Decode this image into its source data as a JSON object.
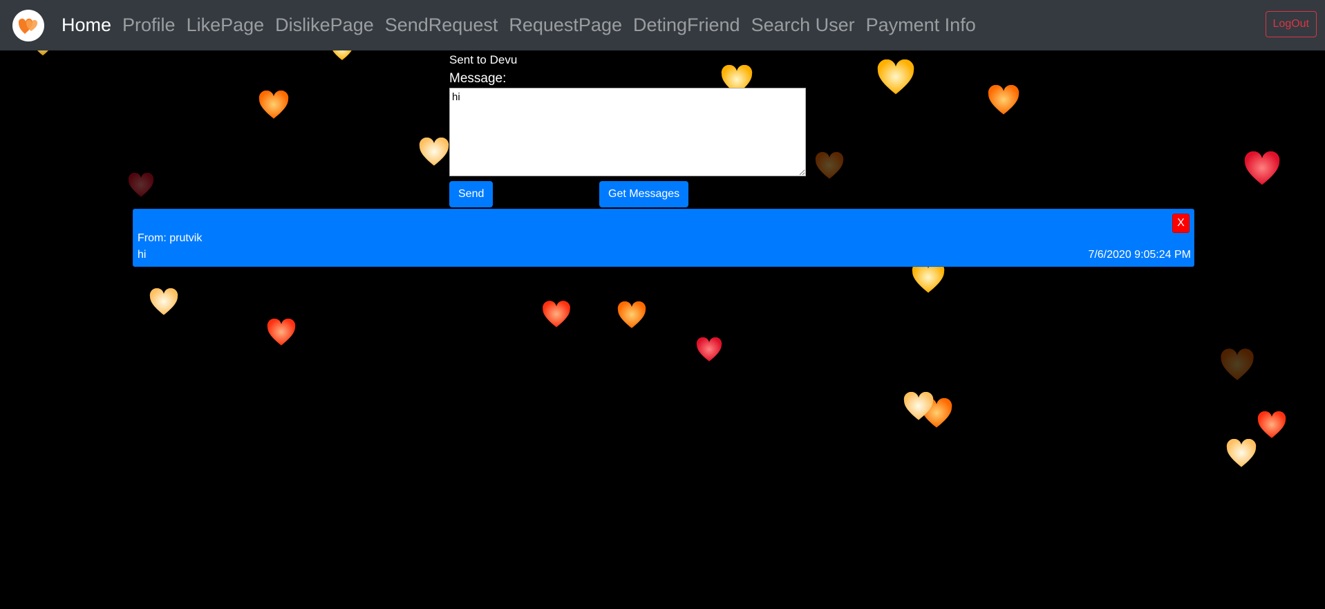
{
  "navbar": {
    "brand_icon": "heart-logo-icon",
    "links": [
      {
        "label": "Home",
        "active": true
      },
      {
        "label": "Profile",
        "active": false
      },
      {
        "label": "LikePage",
        "active": false
      },
      {
        "label": "DislikePage",
        "active": false
      },
      {
        "label": "SendRequest",
        "active": false
      },
      {
        "label": "RequestPage",
        "active": false
      },
      {
        "label": "DetingFriend",
        "active": false
      },
      {
        "label": "Search User",
        "active": false
      },
      {
        "label": "Payment Info",
        "active": false
      }
    ],
    "logout_label": "LogOut"
  },
  "form": {
    "sent_to": "Sent to Devu",
    "message_label": "Message:",
    "message_value": "hi",
    "send_label": "Send",
    "get_messages_label": "Get Messages"
  },
  "messages": [
    {
      "from": "From: prutvik",
      "text": "hi",
      "time": "7/6/2020 9:05:24 PM",
      "close_label": "X"
    }
  ],
  "colors": {
    "navbar_bg": "#343a40",
    "primary": "#007bff",
    "danger": "#dc3545",
    "close_red": "#ff0000"
  }
}
